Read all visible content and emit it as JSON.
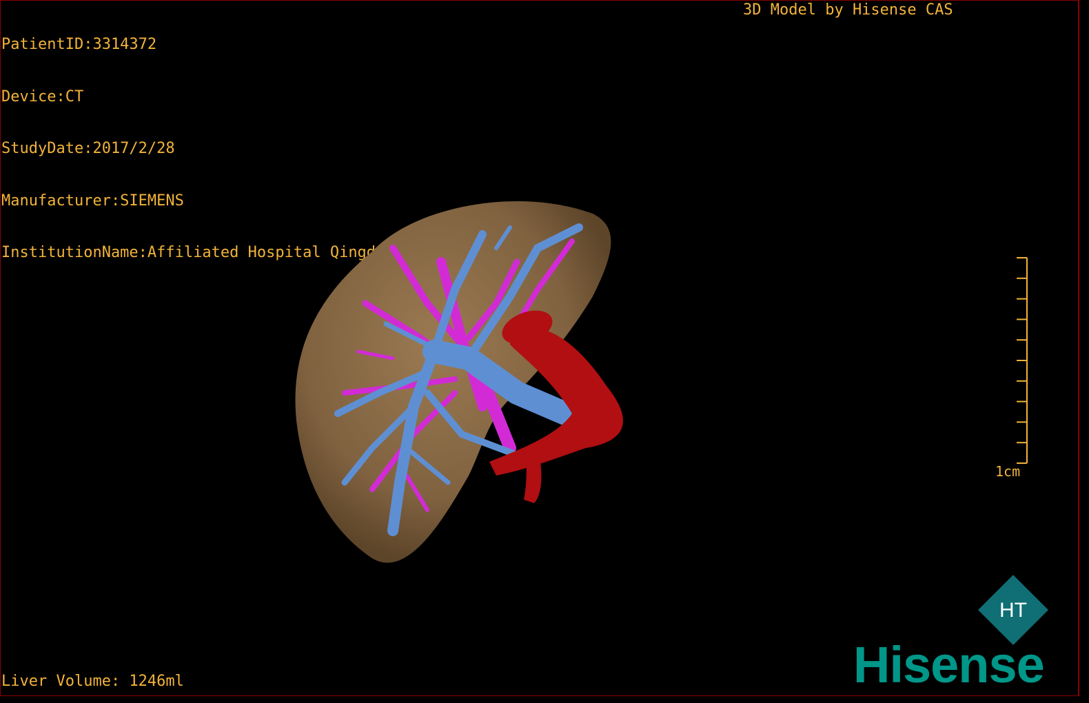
{
  "overlay": {
    "patient_id": "PatientID:3314372",
    "device": "Device:CT",
    "study_date": "StudyDate:2017/2/28",
    "manufacturer": "Manufacturer:SIEMENS",
    "institution": "InstitutionName:Affiliated Hospital Qingdao University-C",
    "model_credit": "3D Model by Hisense CAS",
    "liver_volume": "Liver Volume: 1246ml"
  },
  "scale_bar": {
    "label": "1cm",
    "ticks": 10
  },
  "logo": {
    "text": "Hisense",
    "mark": "HT"
  },
  "colors": {
    "overlay_text": "#f2b33a",
    "liver": "#8a6a45",
    "portal_vein": "#5f8fd3",
    "hepatic_vein": "#d22bd6",
    "artery": "#b10f12",
    "brand": "#009688"
  }
}
